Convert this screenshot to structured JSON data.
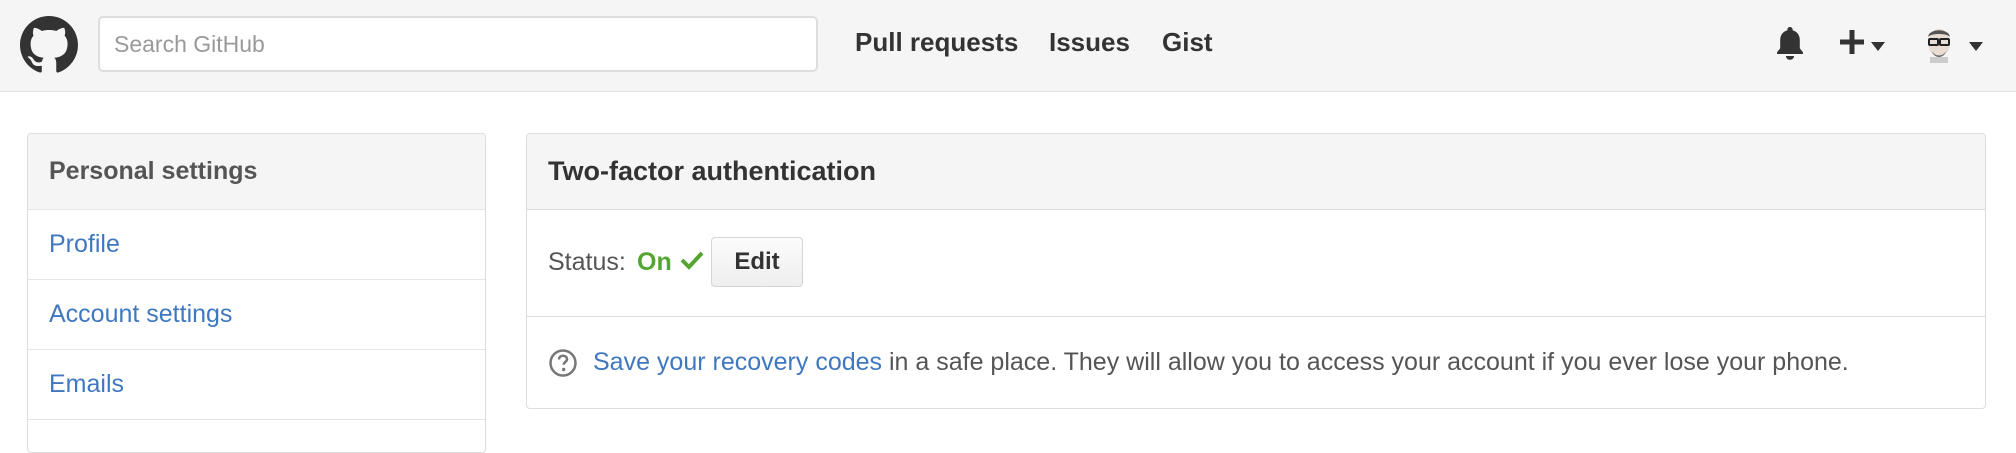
{
  "header": {
    "logo_icon": "github-octocat-icon",
    "search_placeholder": "Search GitHub",
    "nav": [
      "Pull requests",
      "Issues",
      "Gist"
    ],
    "icons": [
      "bell-icon",
      "plus-icon",
      "chevron-down-icon",
      "avatar",
      "chevron-down-icon"
    ]
  },
  "sidebar": {
    "title": "Personal settings",
    "items": [
      "Profile",
      "Account settings",
      "Emails"
    ]
  },
  "panel": {
    "title": "Two-factor authentication",
    "status_label": "Status:",
    "status_value": "On",
    "status_color": "#55a532",
    "edit_label": "Edit",
    "recovery_link": "Save your recovery codes",
    "recovery_text": " in a safe place. They will allow you to access your account if you ever lose your phone."
  },
  "colors": {
    "link": "#4078c0",
    "header_bg": "#f5f5f5"
  }
}
